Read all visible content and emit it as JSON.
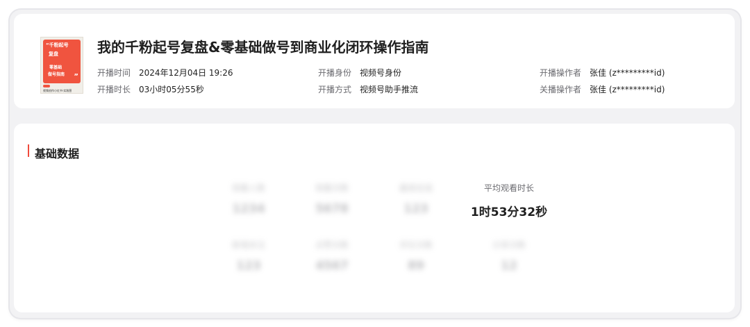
{
  "live": {
    "title": "我的千粉起号复盘&零基础做号到商业化闭环操作指南",
    "cover": {
      "line1": "“千粉起号",
      "line2": "复盘",
      "line3": "零基础",
      "line4": "做号指南",
      "quote_close": "”",
      "footer": "视频创作小红书·实践营"
    },
    "meta": [
      {
        "label": "开播时间",
        "value": "2024年12月04日 19:26"
      },
      {
        "label": "开播时长",
        "value": "03小时05分55秒"
      },
      {
        "label": "开播身份",
        "value": "视频号身份"
      },
      {
        "label": "开播方式",
        "value": "视频号助手推流"
      },
      {
        "label": "开播操作者",
        "value": "张佳 (z*********id)"
      },
      {
        "label": "关播操作者",
        "value": "张佳 (z*********id)"
      }
    ]
  },
  "basic": {
    "section_title": "基础数据",
    "metrics": [
      {
        "label": "观看人数",
        "value": "1234",
        "blurred": true
      },
      {
        "label": "观看次数",
        "value": "5678",
        "blurred": true
      },
      {
        "label": "最高在线",
        "value": "123",
        "blurred": true
      },
      {
        "label": "平均观看时长",
        "value": "1时53分32秒",
        "blurred": false
      },
      {
        "label": "新增关注",
        "value": "123",
        "blurred": true
      },
      {
        "label": "点赞次数",
        "value": "4567",
        "blurred": true
      },
      {
        "label": "评论次数",
        "value": "89",
        "blurred": true
      },
      {
        "label": "分享次数",
        "value": "12",
        "blurred": true
      }
    ]
  },
  "colors": {
    "accent": "#f04a3c",
    "cover": "#f0543f",
    "panel_bg": "#f2f2f4"
  }
}
